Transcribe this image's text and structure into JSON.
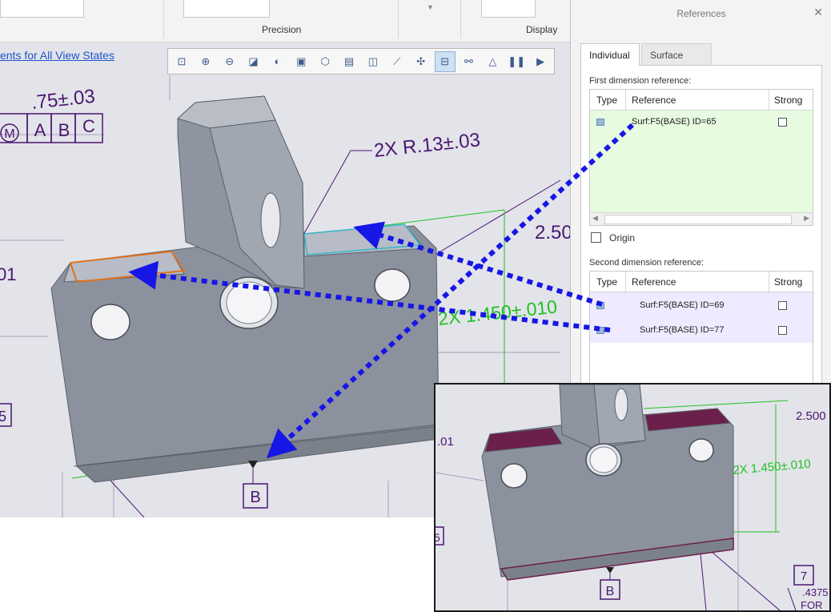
{
  "ribbon": {
    "groups": {
      "precision": "Precision",
      "display": "Display"
    }
  },
  "link": {
    "text": "ents for All View States"
  },
  "toolbar": {
    "icons": [
      "refit-icon",
      "zoom-in-icon",
      "zoom-out-icon",
      "repaint-icon",
      "view-style-icon",
      "saved-orientations-icon",
      "named-views-icon",
      "view-manager-icon",
      "perspective-icon",
      "datum-display-icon",
      "annotation-display-icon",
      "spin-center-icon",
      "show-reference-icon",
      "sketch-view-icon",
      "pause-icon",
      "next-icon"
    ]
  },
  "annotations": {
    "tol_top": ".75±.03",
    "frame_m": "M",
    "frame_a": "A",
    "frame_b": "B",
    "frame_c": "C",
    "radius": "2X R.13±.03",
    "dim_250": "2.50",
    "dim_1450": "2X 1.450±.010",
    "dim_01": "01",
    "datum_b": "B",
    "frag_5": "5"
  },
  "inset": {
    "dim_2500": "2.500",
    "dim_1450": "2X 1.450±.010",
    "dim_01": ".01",
    "datum_b": "B",
    "frag_5": "5",
    "frag_7": "7",
    "frag_4375": ".4375",
    "frag_for": "FOR"
  },
  "panel": {
    "title": "References",
    "tabs": [
      "Individual",
      "Surface Sets"
    ],
    "first_label": "First dimension reference:",
    "second_label": "Second dimension reference:",
    "columns": [
      "Type",
      "Reference",
      "Strong"
    ],
    "first_rows": [
      {
        "reference": "Surf:F5(BASE) ID=65"
      }
    ],
    "second_rows": [
      {
        "reference": "Surf:F5(BASE) ID=69"
      },
      {
        "reference": "Surf:F5(BASE) ID=77"
      }
    ],
    "origin_label": "Origin"
  },
  "colors": {
    "dimension_purple": "#4a1670",
    "dimension_green": "#1ec21e",
    "arrow_blue": "#1616e6",
    "first_row_bg": "#e6fbe0",
    "second_row_bg": "#efeaff",
    "highlight_magenta": "#6b1f4a"
  }
}
